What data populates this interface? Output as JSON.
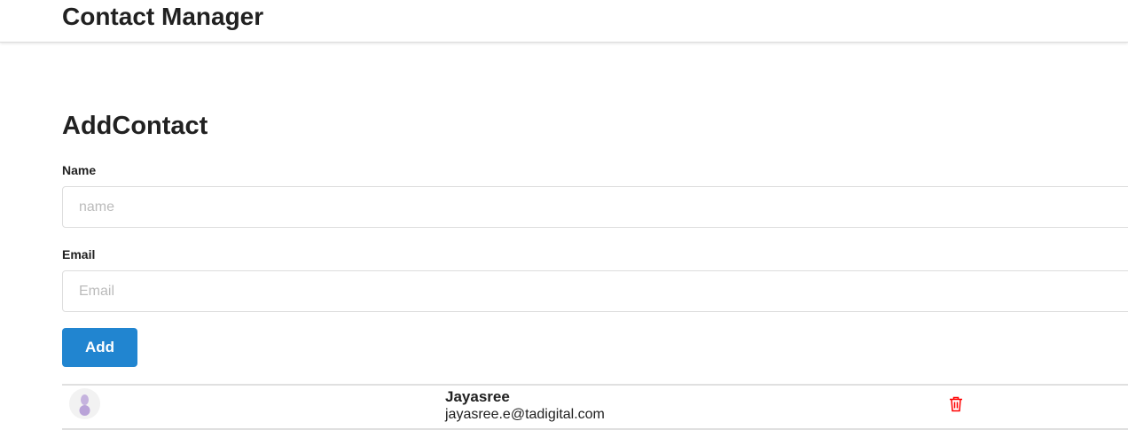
{
  "header": {
    "title": "Contact Manager"
  },
  "form": {
    "title": "AddContact",
    "name_label": "Name",
    "name_placeholder": "name",
    "email_label": "Email",
    "email_placeholder": "Email",
    "add_label": "Add"
  },
  "contacts": [
    {
      "name": "Jayasree",
      "email": "jayasree.e@tadigital.com",
      "avatar_icon": "user-icon",
      "delete_icon": "trash-icon"
    }
  ],
  "colors": {
    "accent": "#2185d0",
    "delete": "#ff0000"
  }
}
